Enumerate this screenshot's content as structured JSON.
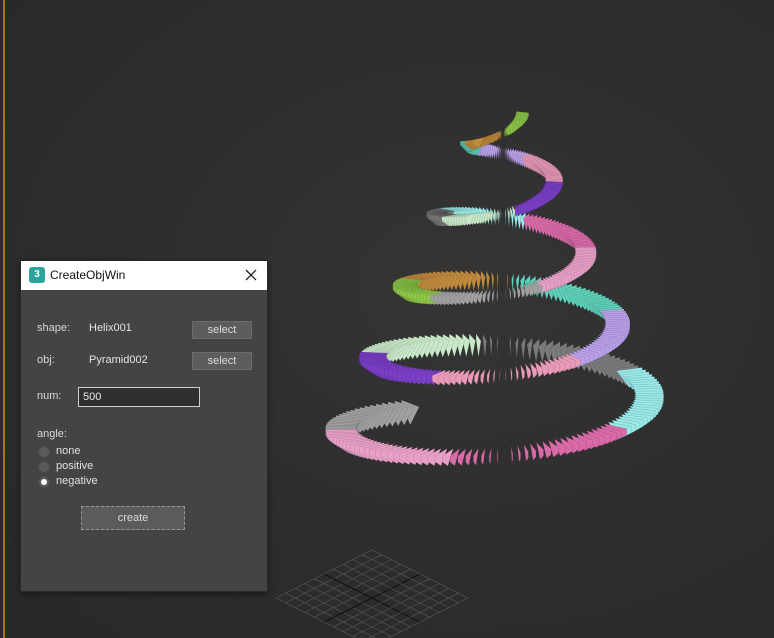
{
  "window": {
    "title": "CreateObjWin",
    "icon": "3ds-max-icon"
  },
  "form": {
    "shape_label": "shape:",
    "shape_value": "Helix001",
    "obj_label": "obj:",
    "obj_value": "Pyramid002",
    "select_label": "select",
    "num_label": "num:",
    "num_value": "500",
    "angle_label": "angle:",
    "angle_options": [
      "none",
      "positive",
      "negative"
    ],
    "angle_selected": "negative",
    "create_label": "create"
  },
  "viewport": {
    "border_color": "#b8860b",
    "segment_colors": [
      "#8fc94a",
      "#c08a3e",
      "#5fcfb8",
      "#b9a0e8",
      "#e89ab8",
      "#7b3fc8",
      "#c8e8c8",
      "#7a7a7a",
      "#9ae8e8",
      "#d96aa8",
      "#e8a0c8",
      "#a0a0a0"
    ]
  }
}
